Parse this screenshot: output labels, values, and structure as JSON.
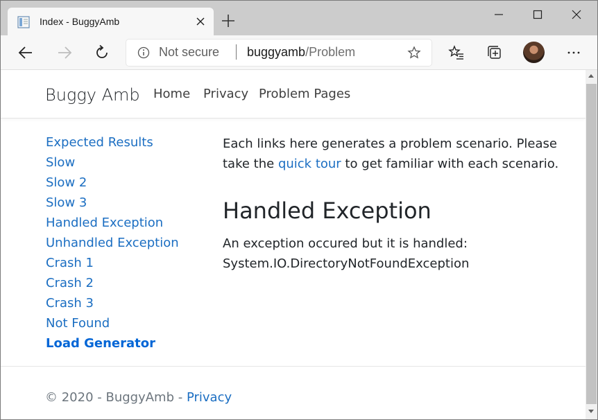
{
  "browser": {
    "tab_title": "Index - BuggyAmb",
    "address": {
      "security_label": "Not secure",
      "host": "buggyamb",
      "path": "/Problem"
    },
    "icons": [
      "favicon-icon",
      "close-icon",
      "plus-icon",
      "minimize-icon",
      "maximize-icon",
      "close-window-icon",
      "back-icon",
      "forward-icon",
      "refresh-icon",
      "info-icon",
      "star-icon",
      "favorites-icon",
      "collections-icon",
      "profile-avatar",
      "more-icon"
    ]
  },
  "site": {
    "brand": "Buggy Amb",
    "nav": [
      "Home",
      "Privacy",
      "Problem Pages"
    ]
  },
  "sidebar": {
    "links": [
      {
        "label": "Expected Results"
      },
      {
        "label": "Slow"
      },
      {
        "label": "Slow 2"
      },
      {
        "label": "Slow 3"
      },
      {
        "label": "Handled Exception"
      },
      {
        "label": "Unhandled Exception"
      },
      {
        "label": "Crash 1"
      },
      {
        "label": "Crash 2"
      },
      {
        "label": "Crash 3"
      },
      {
        "label": "Not Found"
      },
      {
        "label": "Load Generator"
      }
    ]
  },
  "main": {
    "intro_before": "Each links here generates a problem scenario. Please take the ",
    "intro_link": "quick tour",
    "intro_after": " to get familiar with each scenario.",
    "heading": "Handled Exception",
    "message_line1": "An exception occured but it is handled:",
    "message_line2": "System.IO.DirectoryNotFoundException"
  },
  "footer": {
    "copyright": "© 2020 - BuggyAmb - ",
    "privacy_link": "Privacy"
  },
  "colors": {
    "link": "#1b6ec2",
    "text": "#212529",
    "muted": "#6c757d",
    "titlebar": "#cccccc"
  }
}
